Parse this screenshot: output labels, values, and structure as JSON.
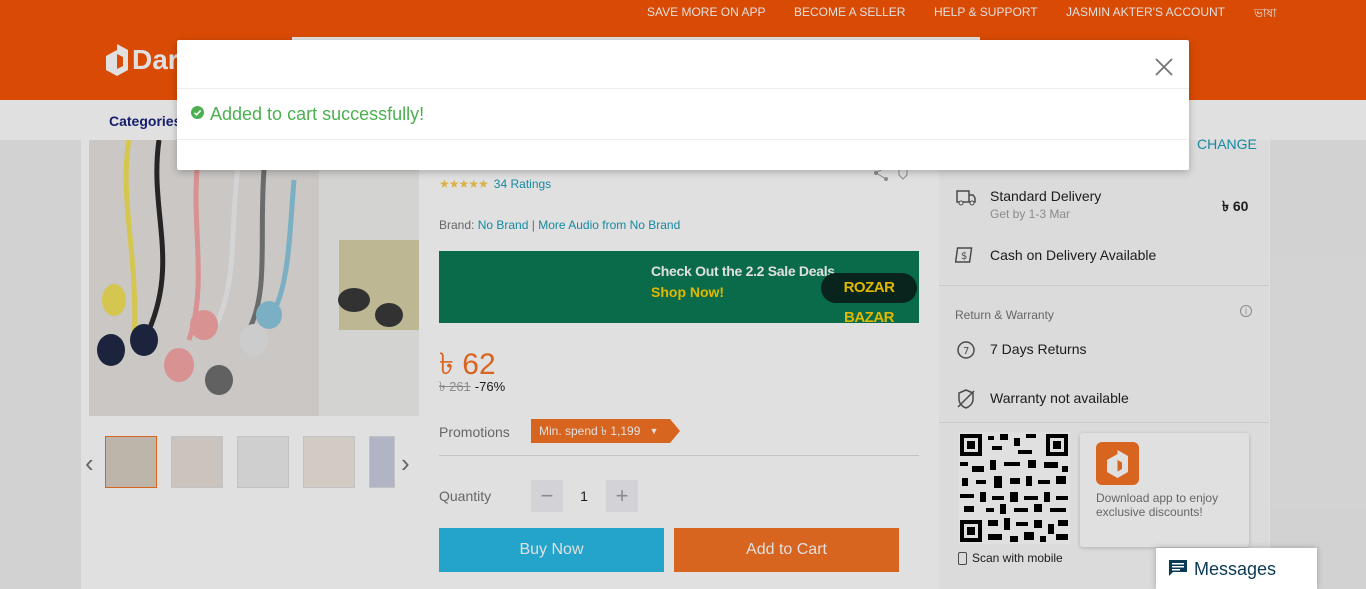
{
  "header": {
    "links": [
      "SAVE MORE ON APP",
      "BECOME A SELLER",
      "HELP & SUPPORT",
      "JASMIN AKTER'S ACCOUNT",
      "ভাষা"
    ],
    "logo_text": "Dara",
    "categories_label": "Categories"
  },
  "product": {
    "rating_stars": "★★★★★",
    "ratings_count": "34 Ratings",
    "brand_label": "Brand:",
    "brand_name": "No Brand",
    "more_from": "More Audio from No Brand",
    "banner": {
      "line1": "Check Out the 2.2 Sale Deals",
      "line2": "Shop Now!",
      "badge": "ROZAR BAZAR"
    },
    "price": "৳ 62",
    "old_price": "৳ 261",
    "discount": "-76%",
    "promotions_label": "Promotions",
    "promotion_tag": "Min. spend ৳ 1,199",
    "quantity_label": "Quantity",
    "quantity_value": "1",
    "minus": "−",
    "plus": "+",
    "buy_now": "Buy Now",
    "add_to_cart": "Add to Cart"
  },
  "delivery": {
    "change": "CHANGE",
    "standard": "Standard Delivery",
    "standard_sub": "Get by 1-3 Mar",
    "fee": "৳ 60",
    "cod": "Cash on Delivery Available",
    "return_heading": "Return & Warranty",
    "returns": "7 Days Returns",
    "warranty": "Warranty not available"
  },
  "app_promo": {
    "scan": "Scan with mobile",
    "text": "Download app to enjoy exclusive discounts!"
  },
  "messages_label": "Messages",
  "modal": {
    "message": "Added to cart successfully!"
  },
  "colors": {
    "brand": "#f85606",
    "accent": "#f57224",
    "buy": "#2abbe8",
    "success": "#4caf50"
  }
}
